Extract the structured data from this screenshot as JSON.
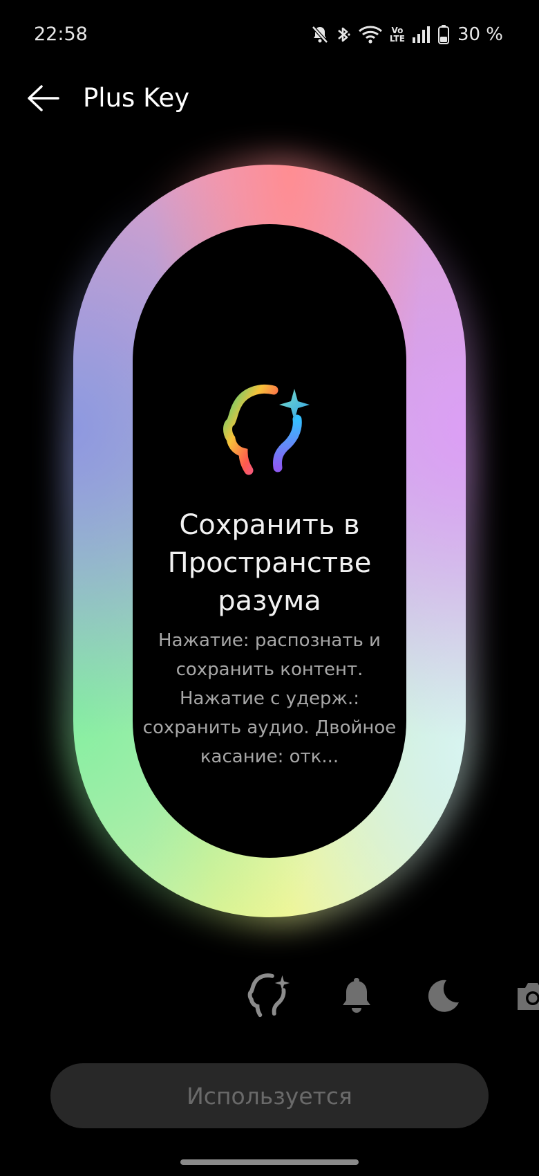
{
  "status_bar": {
    "time": "22:58",
    "icons": [
      "mute-icon",
      "bluetooth-icon",
      "wifi-icon",
      "volte-icon",
      "signal-icon",
      "battery-icon"
    ],
    "volte_top": "Vo",
    "volte_bottom": "LTE",
    "battery_text": "30 %"
  },
  "header": {
    "back_icon": "arrow-left-icon",
    "title": "Plus Key"
  },
  "feature": {
    "icon": "mind-space-icon",
    "title": "Сохранить в Пространстве разума",
    "description": "Нажатие: распознать и сохранить контент. Нажатие с удерж.: сохранить аудио. Двойное касание: отк..."
  },
  "function_icons": [
    "mind-space-icon",
    "bell-icon",
    "moon-icon",
    "camera-icon"
  ],
  "button": {
    "label": "Используется"
  },
  "colors": {
    "ring_top": "#ff8d92",
    "ring_left": "#8e98e0",
    "ring_right": "#dc9ff5",
    "ring_bottom_left": "#86f0a0",
    "ring_bottom": "#f5f680",
    "button_bg": "#282828",
    "button_text": "#6a6a6a"
  }
}
